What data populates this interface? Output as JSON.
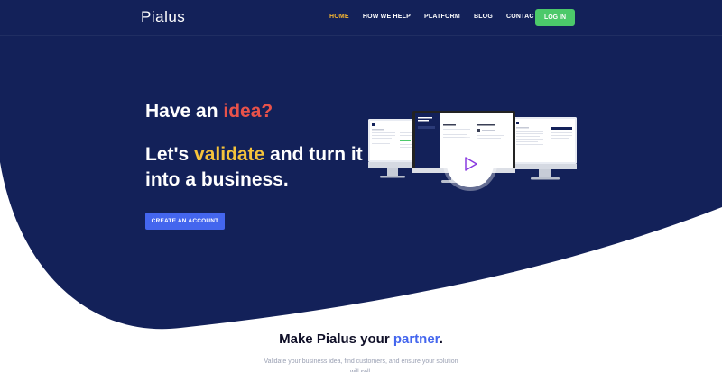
{
  "brand": {
    "name": "Pialus"
  },
  "nav": {
    "items": [
      {
        "label": "HOME",
        "active": true
      },
      {
        "label": "HOW WE HELP",
        "active": false
      },
      {
        "label": "PLATFORM",
        "active": false
      },
      {
        "label": "BLOG",
        "active": false
      },
      {
        "label": "CONTACT",
        "active": false
      }
    ],
    "login_label": "LOG IN"
  },
  "hero": {
    "question_prefix": "Have an ",
    "question_accent": "idea?",
    "headline_prefix": "Let's ",
    "headline_accent": "validate",
    "headline_suffix": " and turn it into a business.",
    "cta_label": "CREATE AN ACCOUNT"
  },
  "partner": {
    "title_prefix": "Make Pialus your ",
    "title_accent": "partner",
    "title_suffix": ".",
    "subtitle": "Validate your business idea, find customers, and ensure your solution will sell."
  },
  "colors": {
    "hero_background": "#132159",
    "active_nav": "#f5b530",
    "login_button": "#4cc96a",
    "accent_red": "#e8524a",
    "accent_yellow": "#f5c33b",
    "accent_blue": "#4466ee"
  },
  "icons": {
    "play": "play-icon"
  }
}
